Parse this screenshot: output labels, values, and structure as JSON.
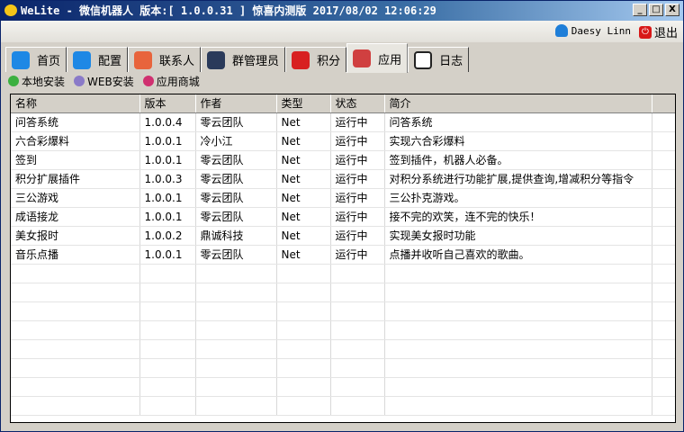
{
  "window": {
    "title": "WeLite - 微信机器人 版本:[ 1.0.0.31 ] 惊喜内测版 2017/08/02 12:06:29",
    "minimize": "_",
    "maximize": "□",
    "close": "X"
  },
  "user": {
    "name": "Daesy Linn",
    "logout": "退出"
  },
  "tabs": [
    {
      "label": "首页",
      "color": "#1e88e5"
    },
    {
      "label": "配置",
      "color": "#1e88e5"
    },
    {
      "label": "联系人",
      "color": "#e8643c"
    },
    {
      "label": "群管理员",
      "color": "#2a3a5a"
    },
    {
      "label": "积分",
      "color": "#d82020"
    },
    {
      "label": "应用",
      "color": "#d04040"
    },
    {
      "label": "日志",
      "color": "#ffffff"
    }
  ],
  "toolbar": [
    {
      "label": "本地安装",
      "color": "#3cb040"
    },
    {
      "label": "WEB安装",
      "color": "#8a7ac8"
    },
    {
      "label": "应用商城",
      "color": "#d03070"
    }
  ],
  "table": {
    "columns": [
      "名称",
      "版本",
      "作者",
      "类型",
      "状态",
      "简介",
      ""
    ],
    "rows": [
      [
        "问答系统",
        "1.0.0.4",
        "零云团队",
        "Net",
        "运行中",
        "问答系统"
      ],
      [
        "六合彩爆料",
        "1.0.0.1",
        "冷小江",
        "Net",
        "运行中",
        "实现六合彩爆料"
      ],
      [
        "签到",
        "1.0.0.1",
        "零云团队",
        "Net",
        "运行中",
        "签到插件，机器人必备。"
      ],
      [
        "积分扩展插件",
        "1.0.0.3",
        "零云团队",
        "Net",
        "运行中",
        "对积分系统进行功能扩展,提供查询,增减积分等指令"
      ],
      [
        "三公游戏",
        "1.0.0.1",
        "零云团队",
        "Net",
        "运行中",
        "三公扑克游戏。"
      ],
      [
        "成语接龙",
        "1.0.0.1",
        "零云团队",
        "Net",
        "运行中",
        "接不完的欢笑，连不完的快乐！"
      ],
      [
        "美女报时",
        "1.0.0.2",
        "鼎诚科技",
        "Net",
        "运行中",
        "实现美女报时功能"
      ],
      [
        "音乐点播",
        "1.0.0.1",
        "零云团队",
        "Net",
        "运行中",
        "点播并收听自己喜欢的歌曲。"
      ]
    ]
  }
}
